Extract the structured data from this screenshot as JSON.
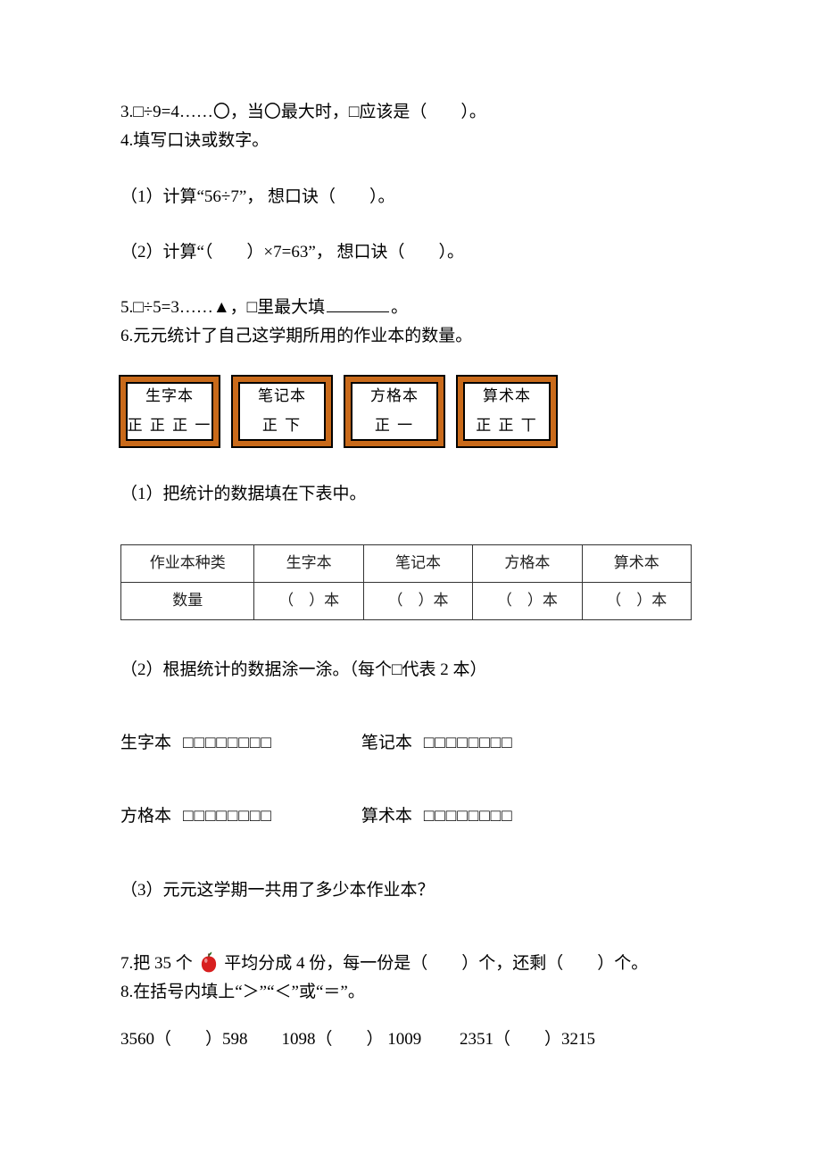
{
  "q3": "3.□÷9=4……〇，当〇最大时，□应该是（　　）。",
  "q4": "4.填写口诀或数字。",
  "q4s1": "（1）计算“56÷7”， 想口诀（　　）。",
  "q4s2": "（2）计算“（　　）×7=63”， 想口诀（　　）。",
  "q5_pre": "5.□÷5=3……▲，□里最大填",
  "q5_post": "。",
  "q6": "6.元元统计了自己这学期所用的作业本的数量。",
  "tally": [
    {
      "name": "生字本",
      "marks": "正 正 正 一"
    },
    {
      "name": "笔记本",
      "marks": "正 下"
    },
    {
      "name": "方格本",
      "marks": "正 一"
    },
    {
      "name": "算术本",
      "marks": "正 正 丅"
    }
  ],
  "q6s1": "（1）把统计的数据填在下表中。",
  "table": {
    "header": [
      "作业本种类",
      "生字本",
      "笔记本",
      "方格本",
      "算术本"
    ],
    "row2label": "数量",
    "cell": "（　）本"
  },
  "q6s2": "（2）根据统计的数据涂一涂。（每个□代表 2 本）",
  "colorLabels": [
    "生字本",
    "笔记本",
    "方格本",
    "算术本"
  ],
  "boxes": "□□□□□□□□",
  "q6s3": "（3）元元这学期一共用了多少本作业本？",
  "q7_pre": "7.把 35 个",
  "q7_post": "平均分成 4 份，每一份是（　　）个，还剩（　　）个。",
  "q8": "8.在括号内填上“＞”“＜”或“＝”。",
  "q8line": "3560（　　）598　　1098（　　） 1009　　 2351（　　）3215"
}
